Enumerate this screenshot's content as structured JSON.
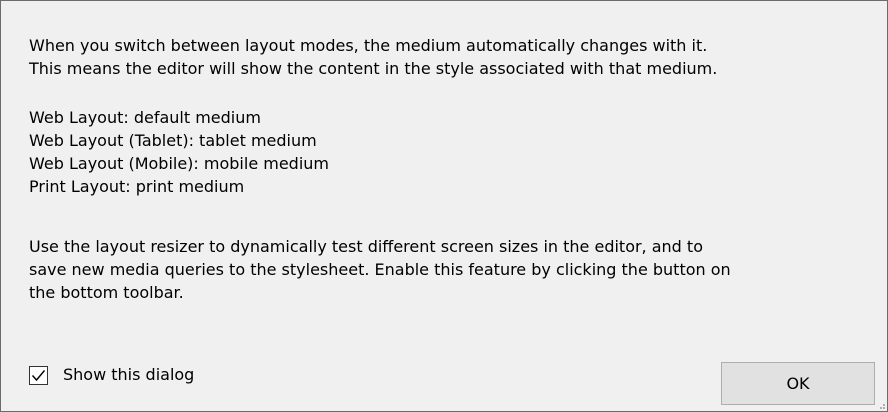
{
  "dialog": {
    "intro_lines": [
      "When you switch between layout modes, the medium automatically changes with it.",
      "This means the editor will show the content in the style associated with that medium."
    ],
    "mode_lines": [
      "Web Layout: default medium",
      "Web Layout (Tablet): tablet medium",
      "Web Layout (Mobile): mobile medium",
      "Print Layout: print medium"
    ],
    "resizer_lines": [
      "Use the layout resizer to dynamically test different screen sizes in the editor, and to",
      "save new media queries to the stylesheet. Enable this feature by clicking the button on",
      "the bottom toolbar."
    ],
    "show_dialog_label": "Show this dialog",
    "show_dialog_checked": true,
    "ok_label": "OK"
  },
  "icons": {
    "checkbox": "checkmark-icon",
    "resize": "resize-grip-icon"
  }
}
